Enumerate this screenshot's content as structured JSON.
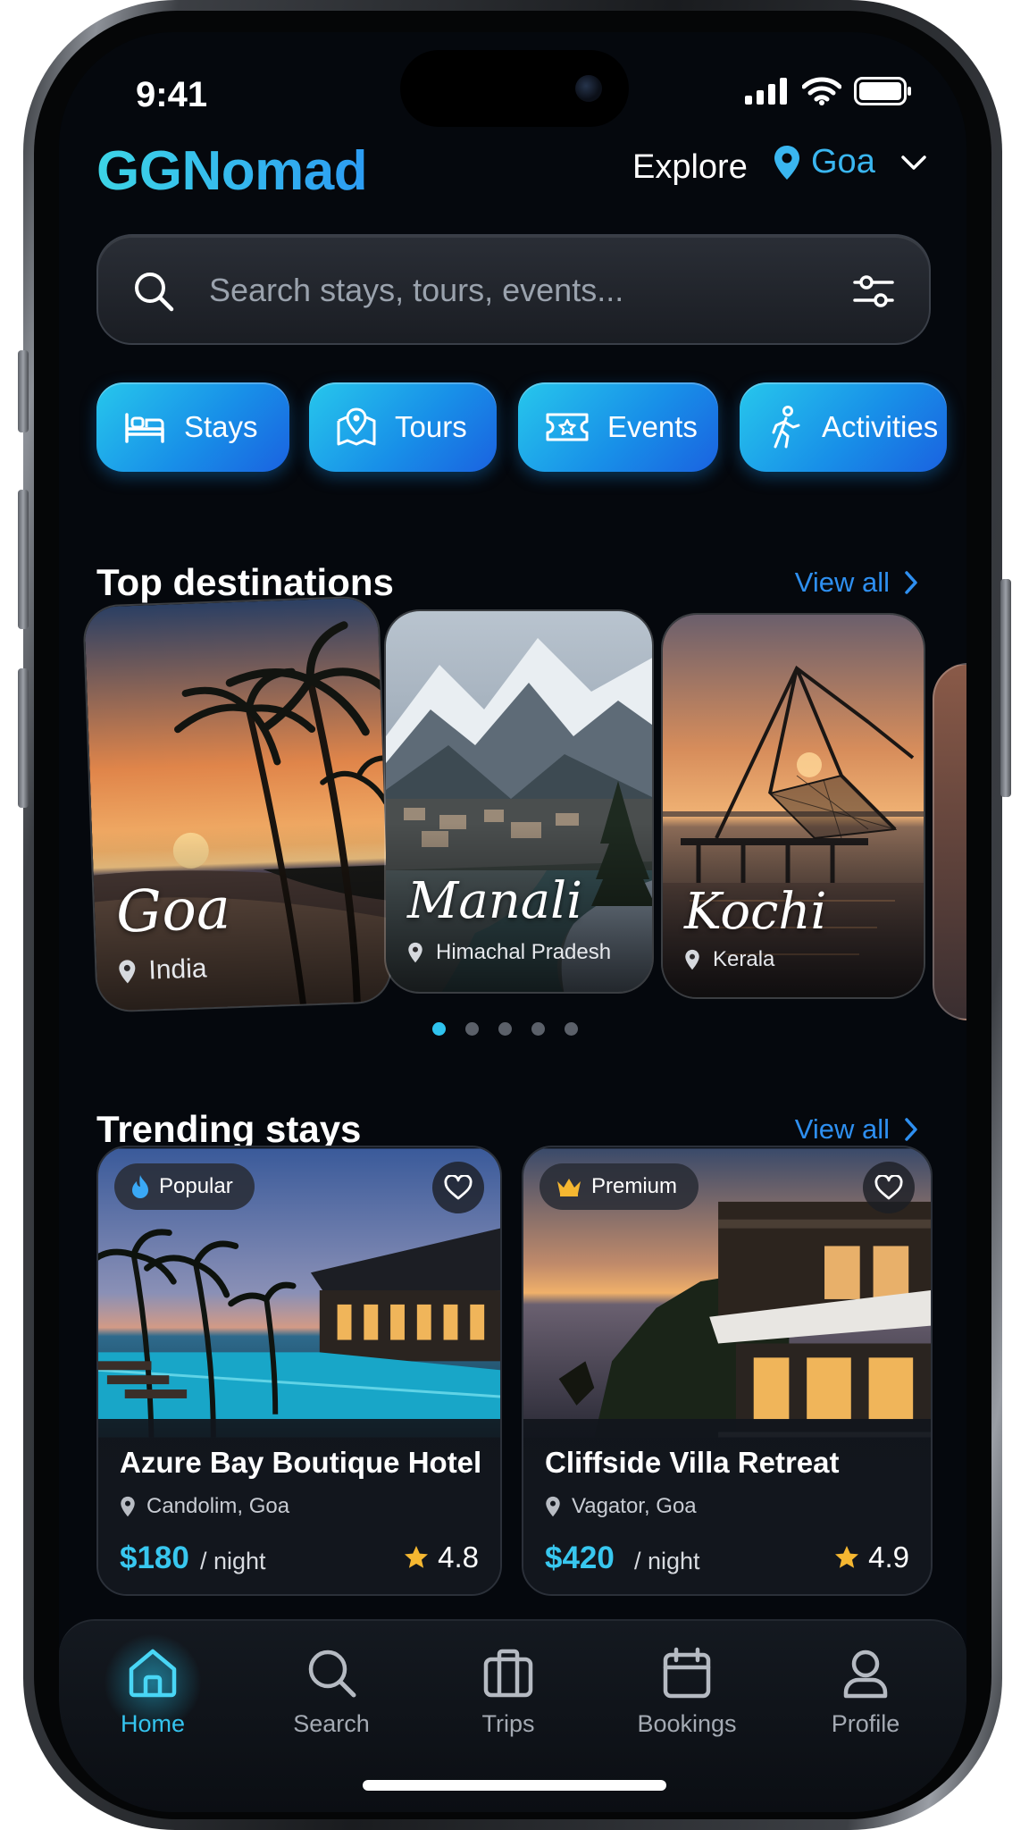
{
  "status": {
    "time": "9:41"
  },
  "header": {
    "brand": "GGNomad",
    "explore": "Explore",
    "location": "Goa"
  },
  "search": {
    "placeholder": "Search stays, tours, events..."
  },
  "categories": [
    {
      "label": "Stays",
      "icon": "bed-icon"
    },
    {
      "label": "Tours",
      "icon": "map-pin-icon"
    },
    {
      "label": "Events",
      "icon": "ticket-icon"
    },
    {
      "label": "Activities",
      "icon": "hiking-icon"
    }
  ],
  "top_destinations": {
    "title": "Top destinations",
    "view_all": "View all",
    "items": [
      {
        "name": "Goa",
        "region": "India"
      },
      {
        "name": "Manali",
        "region": "Himachal Pradesh"
      },
      {
        "name": "Kochi",
        "region": "Kerala"
      }
    ],
    "page_count": 5,
    "active_page": 1
  },
  "trending_stays": {
    "title": "Trending stays",
    "view_all": "View all",
    "items": [
      {
        "badge": "Popular",
        "badge_icon": "flame-icon",
        "name": "Azure Bay Boutique Hotel",
        "location": "Candolim, Goa",
        "price": "$180",
        "per": "/ night",
        "rating": "4.8"
      },
      {
        "badge": "Premium",
        "badge_icon": "crown-icon",
        "name": "Cliffside Villa Retreat",
        "location": "Vagator, Goa",
        "price": "$420",
        "per": "/ night",
        "rating": "4.9"
      }
    ]
  },
  "nav": {
    "active": "Home",
    "items": [
      {
        "label": "Home",
        "icon": "home-icon"
      },
      {
        "label": "Search",
        "icon": "search-icon"
      },
      {
        "label": "Trips",
        "icon": "suitcase-icon"
      },
      {
        "label": "Bookings",
        "icon": "calendar-icon"
      },
      {
        "label": "Profile",
        "icon": "user-icon"
      }
    ]
  },
  "colors": {
    "accent": "#35c4ef",
    "link": "#2e8ff0",
    "background": "#05080d",
    "star": "#f5b731"
  }
}
